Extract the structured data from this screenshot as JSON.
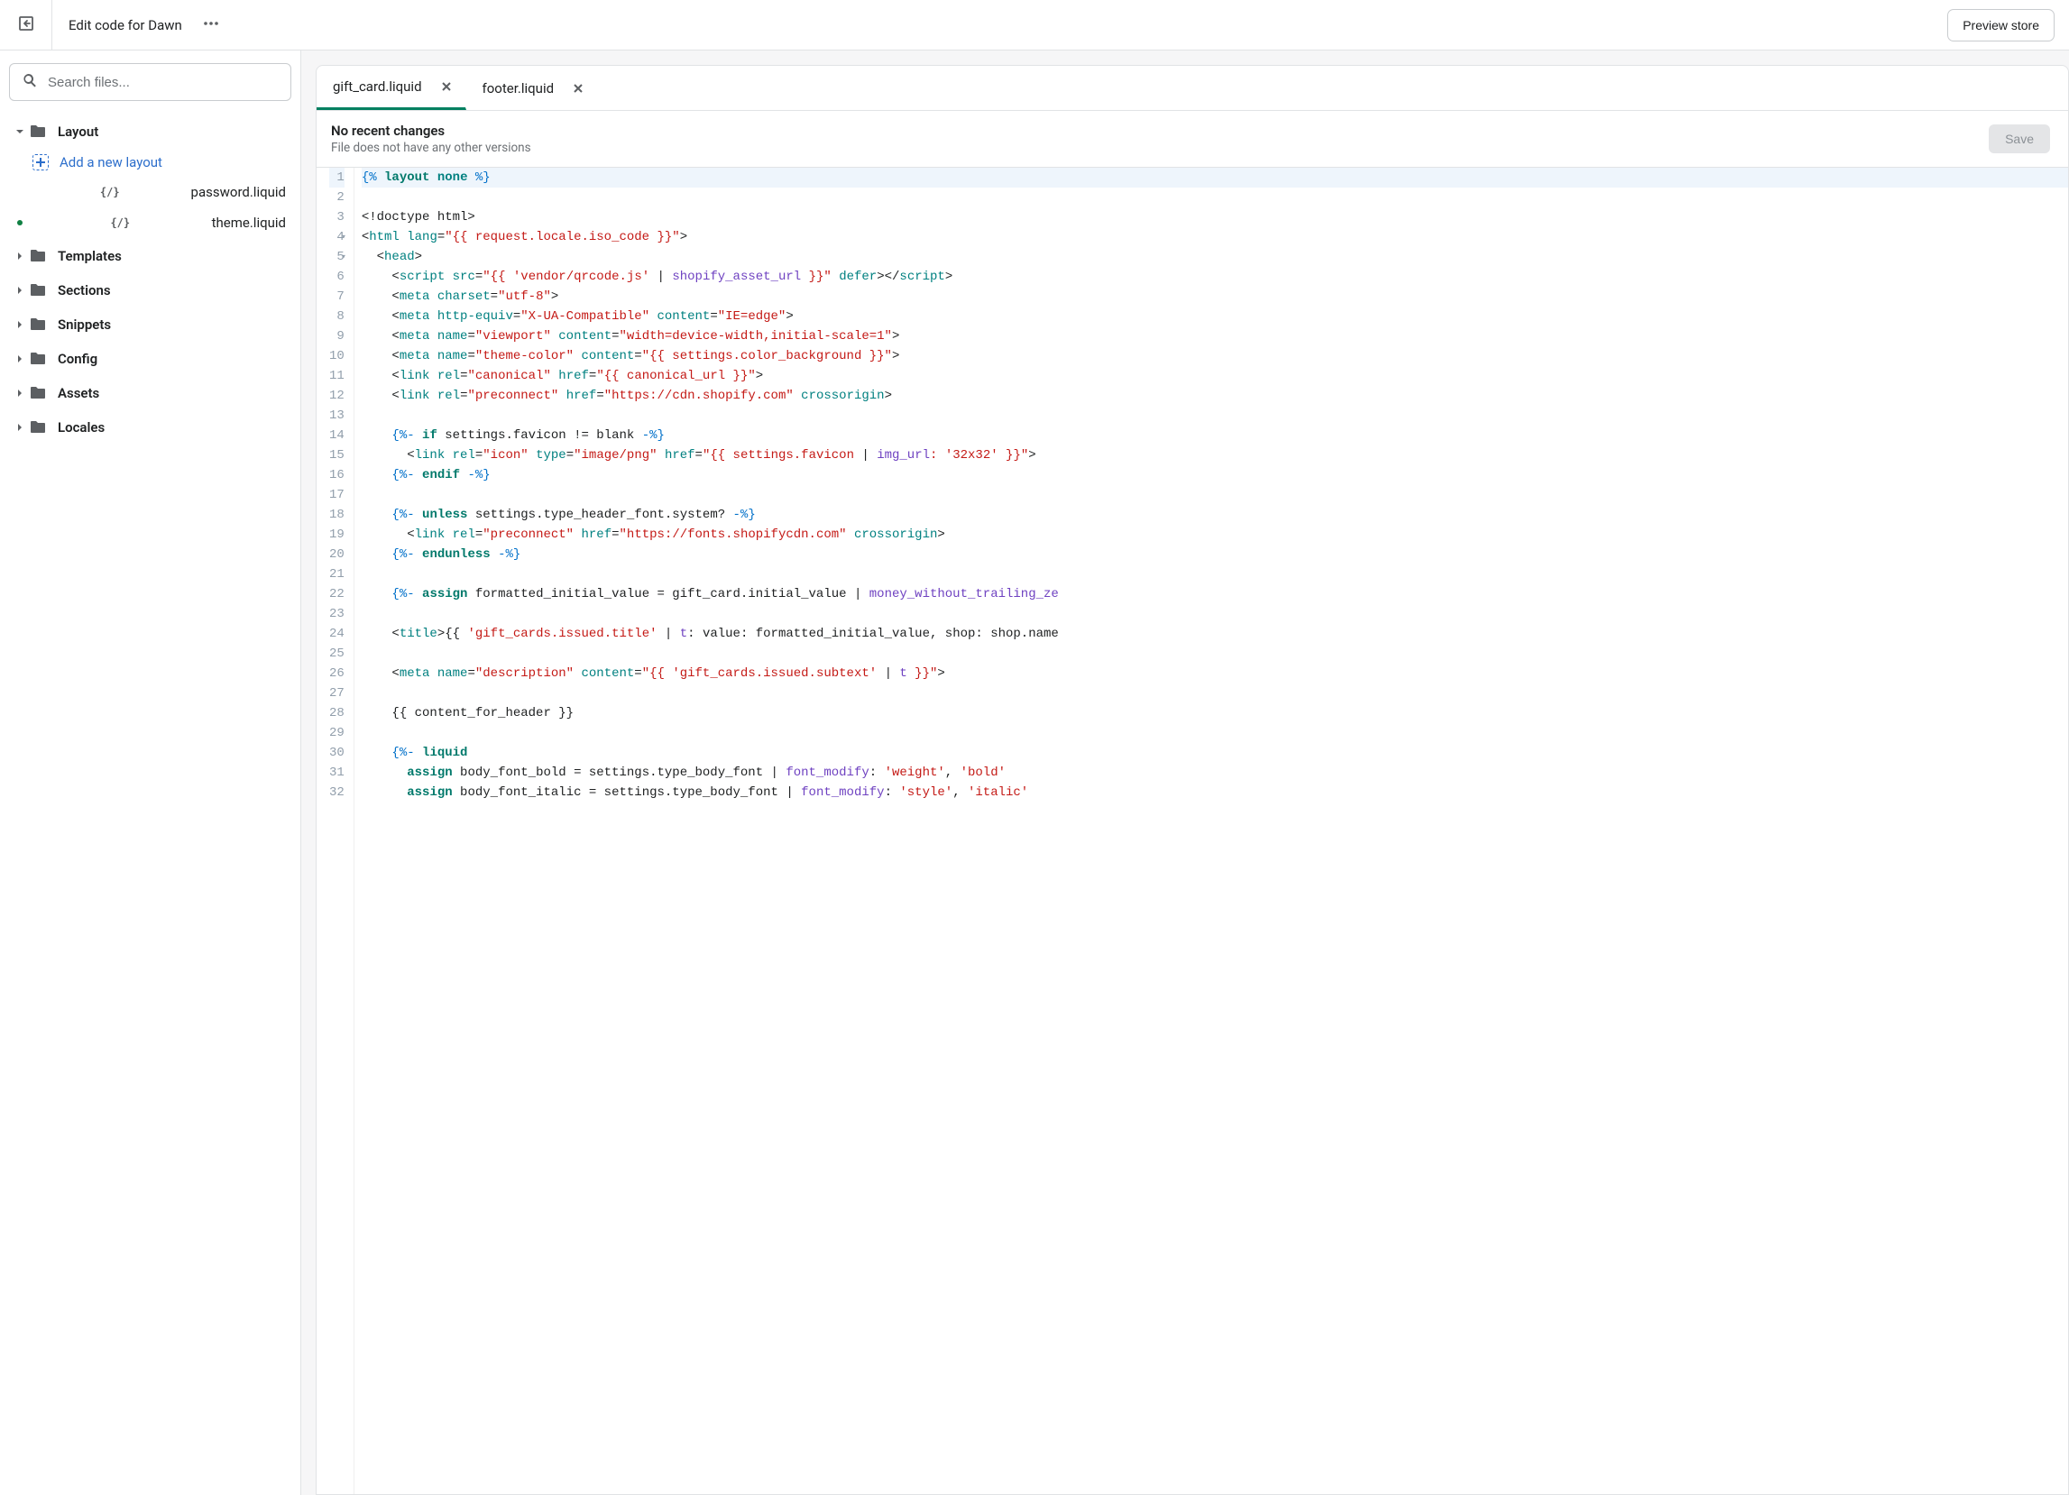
{
  "topbar": {
    "title": "Edit code for Dawn",
    "preview_label": "Preview store"
  },
  "sidebar": {
    "search_placeholder": "Search files...",
    "sections": [
      {
        "label": "Layout",
        "expanded": true,
        "children": [
          {
            "label": "Add a new layout",
            "type": "add"
          },
          {
            "label": "password.liquid",
            "type": "code",
            "modified": false
          },
          {
            "label": "theme.liquid",
            "type": "code",
            "modified": true
          }
        ]
      },
      {
        "label": "Templates",
        "expanded": false
      },
      {
        "label": "Sections",
        "expanded": false
      },
      {
        "label": "Snippets",
        "expanded": false
      },
      {
        "label": "Config",
        "expanded": false
      },
      {
        "label": "Assets",
        "expanded": false
      },
      {
        "label": "Locales",
        "expanded": false
      }
    ]
  },
  "editor": {
    "tabs": [
      {
        "label": "gift_card.liquid",
        "active": true
      },
      {
        "label": "footer.liquid",
        "active": false
      }
    ],
    "filebar": {
      "title": "No recent changes",
      "subtitle": "File does not have any other versions",
      "save_label": "Save"
    },
    "code_lines": [
      {
        "n": 1,
        "hl": true,
        "fold": "",
        "tokens": [
          [
            "c-delim",
            "{%"
          ],
          [
            "c-txt",
            " "
          ],
          [
            "c-kw",
            "layout"
          ],
          [
            "c-txt",
            " "
          ],
          [
            "c-kw2",
            "none"
          ],
          [
            "c-txt",
            " "
          ],
          [
            "c-delim",
            "%}"
          ]
        ]
      },
      {
        "n": 2,
        "tokens": []
      },
      {
        "n": 3,
        "tokens": [
          [
            "c-txt",
            "<!doctype html>"
          ]
        ]
      },
      {
        "n": 4,
        "fold": "v",
        "tokens": [
          [
            "c-txt",
            "<"
          ],
          [
            "c-tag",
            "html"
          ],
          [
            "c-txt",
            " "
          ],
          [
            "c-attr",
            "lang"
          ],
          [
            "c-txt",
            "="
          ],
          [
            "c-str",
            "\"{{ request.locale.iso_code }}\""
          ],
          [
            "c-txt",
            ">"
          ]
        ]
      },
      {
        "n": 5,
        "fold": "v",
        "tokens": [
          [
            "c-txt",
            "  <"
          ],
          [
            "c-tag",
            "head"
          ],
          [
            "c-txt",
            ">"
          ]
        ]
      },
      {
        "n": 6,
        "tokens": [
          [
            "c-txt",
            "    <"
          ],
          [
            "c-tag",
            "script"
          ],
          [
            "c-txt",
            " "
          ],
          [
            "c-attr",
            "src"
          ],
          [
            "c-txt",
            "="
          ],
          [
            "c-str",
            "\"{{ "
          ],
          [
            "c-str",
            "'vendor/qrcode.js'"
          ],
          [
            "c-str",
            " "
          ],
          [
            "c-txt",
            "|"
          ],
          [
            "c-str",
            " "
          ],
          [
            "c-filter",
            "shopify_asset_url"
          ],
          [
            "c-str",
            " }}\""
          ],
          [
            "c-txt",
            " "
          ],
          [
            "c-attr",
            "defer"
          ],
          [
            "c-txt",
            "></"
          ],
          [
            "c-tag",
            "script"
          ],
          [
            "c-txt",
            ">"
          ]
        ]
      },
      {
        "n": 7,
        "tokens": [
          [
            "c-txt",
            "    <"
          ],
          [
            "c-tag",
            "meta"
          ],
          [
            "c-txt",
            " "
          ],
          [
            "c-attr",
            "charset"
          ],
          [
            "c-txt",
            "="
          ],
          [
            "c-str",
            "\"utf-8\""
          ],
          [
            "c-txt",
            ">"
          ]
        ]
      },
      {
        "n": 8,
        "tokens": [
          [
            "c-txt",
            "    <"
          ],
          [
            "c-tag",
            "meta"
          ],
          [
            "c-txt",
            " "
          ],
          [
            "c-attr",
            "http-equiv"
          ],
          [
            "c-txt",
            "="
          ],
          [
            "c-str",
            "\"X-UA-Compatible\""
          ],
          [
            "c-txt",
            " "
          ],
          [
            "c-attr",
            "content"
          ],
          [
            "c-txt",
            "="
          ],
          [
            "c-str",
            "\"IE=edge\""
          ],
          [
            "c-txt",
            ">"
          ]
        ]
      },
      {
        "n": 9,
        "tokens": [
          [
            "c-txt",
            "    <"
          ],
          [
            "c-tag",
            "meta"
          ],
          [
            "c-txt",
            " "
          ],
          [
            "c-attr",
            "name"
          ],
          [
            "c-txt",
            "="
          ],
          [
            "c-str",
            "\"viewport\""
          ],
          [
            "c-txt",
            " "
          ],
          [
            "c-attr",
            "content"
          ],
          [
            "c-txt",
            "="
          ],
          [
            "c-str",
            "\"width=device-width,initial-scale=1\""
          ],
          [
            "c-txt",
            ">"
          ]
        ]
      },
      {
        "n": 10,
        "tokens": [
          [
            "c-txt",
            "    <"
          ],
          [
            "c-tag",
            "meta"
          ],
          [
            "c-txt",
            " "
          ],
          [
            "c-attr",
            "name"
          ],
          [
            "c-txt",
            "="
          ],
          [
            "c-str",
            "\"theme-color\""
          ],
          [
            "c-txt",
            " "
          ],
          [
            "c-attr",
            "content"
          ],
          [
            "c-txt",
            "="
          ],
          [
            "c-str",
            "\"{{ settings.color_background }}\""
          ],
          [
            "c-txt",
            ">"
          ]
        ]
      },
      {
        "n": 11,
        "tokens": [
          [
            "c-txt",
            "    <"
          ],
          [
            "c-tag",
            "link"
          ],
          [
            "c-txt",
            " "
          ],
          [
            "c-attr",
            "rel"
          ],
          [
            "c-txt",
            "="
          ],
          [
            "c-str",
            "\"canonical\""
          ],
          [
            "c-txt",
            " "
          ],
          [
            "c-attr",
            "href"
          ],
          [
            "c-txt",
            "="
          ],
          [
            "c-str",
            "\"{{ canonical_url }}\""
          ],
          [
            "c-txt",
            ">"
          ]
        ]
      },
      {
        "n": 12,
        "tokens": [
          [
            "c-txt",
            "    <"
          ],
          [
            "c-tag",
            "link"
          ],
          [
            "c-txt",
            " "
          ],
          [
            "c-attr",
            "rel"
          ],
          [
            "c-txt",
            "="
          ],
          [
            "c-str",
            "\"preconnect\""
          ],
          [
            "c-txt",
            " "
          ],
          [
            "c-attr",
            "href"
          ],
          [
            "c-txt",
            "="
          ],
          [
            "c-str",
            "\"https://cdn.shopify.com\""
          ],
          [
            "c-txt",
            " "
          ],
          [
            "c-attr",
            "crossorigin"
          ],
          [
            "c-txt",
            ">"
          ]
        ]
      },
      {
        "n": 13,
        "tokens": []
      },
      {
        "n": 14,
        "tokens": [
          [
            "c-txt",
            "    "
          ],
          [
            "c-delim",
            "{%-"
          ],
          [
            "c-txt",
            " "
          ],
          [
            "c-kw",
            "if"
          ],
          [
            "c-txt",
            " settings.favicon != blank "
          ],
          [
            "c-delim",
            "-%}"
          ]
        ]
      },
      {
        "n": 15,
        "tokens": [
          [
            "c-txt",
            "      <"
          ],
          [
            "c-tag",
            "link"
          ],
          [
            "c-txt",
            " "
          ],
          [
            "c-attr",
            "rel"
          ],
          [
            "c-txt",
            "="
          ],
          [
            "c-str",
            "\"icon\""
          ],
          [
            "c-txt",
            " "
          ],
          [
            "c-attr",
            "type"
          ],
          [
            "c-txt",
            "="
          ],
          [
            "c-str",
            "\"image/png\""
          ],
          [
            "c-txt",
            " "
          ],
          [
            "c-attr",
            "href"
          ],
          [
            "c-txt",
            "="
          ],
          [
            "c-str",
            "\"{{ settings.favicon "
          ],
          [
            "c-txt",
            "|"
          ],
          [
            "c-str",
            " "
          ],
          [
            "c-filter",
            "img_url"
          ],
          [
            "c-str",
            ": "
          ],
          [
            "c-str",
            "'32x32'"
          ],
          [
            "c-str",
            " }}\""
          ],
          [
            "c-txt",
            ">"
          ]
        ]
      },
      {
        "n": 16,
        "tokens": [
          [
            "c-txt",
            "    "
          ],
          [
            "c-delim",
            "{%-"
          ],
          [
            "c-txt",
            " "
          ],
          [
            "c-kw",
            "endif"
          ],
          [
            "c-txt",
            " "
          ],
          [
            "c-delim",
            "-%}"
          ]
        ]
      },
      {
        "n": 17,
        "tokens": []
      },
      {
        "n": 18,
        "tokens": [
          [
            "c-txt",
            "    "
          ],
          [
            "c-delim",
            "{%-"
          ],
          [
            "c-txt",
            " "
          ],
          [
            "c-kw",
            "unless"
          ],
          [
            "c-txt",
            " settings.type_header_font.system? "
          ],
          [
            "c-delim",
            "-%}"
          ]
        ]
      },
      {
        "n": 19,
        "tokens": [
          [
            "c-txt",
            "      <"
          ],
          [
            "c-tag",
            "link"
          ],
          [
            "c-txt",
            " "
          ],
          [
            "c-attr",
            "rel"
          ],
          [
            "c-txt",
            "="
          ],
          [
            "c-str",
            "\"preconnect\""
          ],
          [
            "c-txt",
            " "
          ],
          [
            "c-attr",
            "href"
          ],
          [
            "c-txt",
            "="
          ],
          [
            "c-str",
            "\"https://fonts.shopifycdn.com\""
          ],
          [
            "c-txt",
            " "
          ],
          [
            "c-attr",
            "crossorigin"
          ],
          [
            "c-txt",
            ">"
          ]
        ]
      },
      {
        "n": 20,
        "tokens": [
          [
            "c-txt",
            "    "
          ],
          [
            "c-delim",
            "{%-"
          ],
          [
            "c-txt",
            " "
          ],
          [
            "c-kw",
            "endunless"
          ],
          [
            "c-txt",
            " "
          ],
          [
            "c-delim",
            "-%}"
          ]
        ]
      },
      {
        "n": 21,
        "tokens": []
      },
      {
        "n": 22,
        "tokens": [
          [
            "c-txt",
            "    "
          ],
          [
            "c-delim",
            "{%-"
          ],
          [
            "c-txt",
            " "
          ],
          [
            "c-kw",
            "assign"
          ],
          [
            "c-txt",
            " formatted_initial_value = gift_card.initial_value "
          ],
          [
            "c-txt",
            "|"
          ],
          [
            "c-txt",
            " "
          ],
          [
            "c-filter",
            "money_without_trailing_ze"
          ]
        ]
      },
      {
        "n": 23,
        "tokens": []
      },
      {
        "n": 24,
        "tokens": [
          [
            "c-txt",
            "    <"
          ],
          [
            "c-tag",
            "title"
          ],
          [
            "c-txt",
            ">"
          ],
          [
            "c-txt",
            "{{ "
          ],
          [
            "c-str",
            "'gift_cards.issued.title'"
          ],
          [
            "c-txt",
            " | "
          ],
          [
            "c-filter",
            "t"
          ],
          [
            "c-txt",
            ": value: formatted_initial_value, shop: shop.name"
          ]
        ]
      },
      {
        "n": 25,
        "tokens": []
      },
      {
        "n": 26,
        "tokens": [
          [
            "c-txt",
            "    <"
          ],
          [
            "c-tag",
            "meta"
          ],
          [
            "c-txt",
            " "
          ],
          [
            "c-attr",
            "name"
          ],
          [
            "c-txt",
            "="
          ],
          [
            "c-str",
            "\"description\""
          ],
          [
            "c-txt",
            " "
          ],
          [
            "c-attr",
            "content"
          ],
          [
            "c-txt",
            "="
          ],
          [
            "c-str",
            "\"{{ "
          ],
          [
            "c-str",
            "'gift_cards.issued.subtext'"
          ],
          [
            "c-str",
            " "
          ],
          [
            "c-txt",
            "|"
          ],
          [
            "c-str",
            " "
          ],
          [
            "c-filter",
            "t"
          ],
          [
            "c-str",
            " }}\""
          ],
          [
            "c-txt",
            ">"
          ]
        ]
      },
      {
        "n": 27,
        "tokens": []
      },
      {
        "n": 28,
        "tokens": [
          [
            "c-txt",
            "    {{ content_for_header }}"
          ]
        ]
      },
      {
        "n": 29,
        "tokens": []
      },
      {
        "n": 30,
        "tokens": [
          [
            "c-txt",
            "    "
          ],
          [
            "c-delim",
            "{%-"
          ],
          [
            "c-txt",
            " "
          ],
          [
            "c-kw",
            "liquid"
          ]
        ]
      },
      {
        "n": 31,
        "tokens": [
          [
            "c-txt",
            "      "
          ],
          [
            "c-kw",
            "assign"
          ],
          [
            "c-txt",
            " body_font_bold = settings.type_body_font "
          ],
          [
            "c-txt",
            "|"
          ],
          [
            "c-txt",
            " "
          ],
          [
            "c-filter",
            "font_modify"
          ],
          [
            "c-txt",
            ": "
          ],
          [
            "c-str",
            "'weight'"
          ],
          [
            "c-txt",
            ", "
          ],
          [
            "c-str",
            "'bold'"
          ]
        ]
      },
      {
        "n": 32,
        "tokens": [
          [
            "c-txt",
            "      "
          ],
          [
            "c-kw",
            "assign"
          ],
          [
            "c-txt",
            " body_font_italic = settings.type_body_font "
          ],
          [
            "c-txt",
            "|"
          ],
          [
            "c-txt",
            " "
          ],
          [
            "c-filter",
            "font_modify"
          ],
          [
            "c-txt",
            ": "
          ],
          [
            "c-str",
            "'style'"
          ],
          [
            "c-txt",
            ", "
          ],
          [
            "c-str",
            "'italic'"
          ]
        ]
      }
    ]
  }
}
